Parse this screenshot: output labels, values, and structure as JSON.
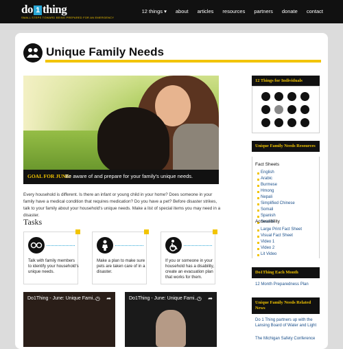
{
  "header": {
    "logo_left": "do",
    "logo_one": "1",
    "logo_right": "thing",
    "tagline": "SMALL STEPS TOWARD BEING PREPARED FOR AN EMERGENCY",
    "nav": [
      "12 things ▾",
      "about",
      "articles",
      "resources",
      "partners",
      "donate",
      "contact"
    ]
  },
  "page": {
    "title": "Unique Family Needs",
    "title_icon": "family-icon",
    "goal_label": "GOAL FOR JUNE:",
    "goal_text": "Be aware of and prepare for your family's unique needs.",
    "intro": "Every household is different. Is there an infant or young child in your home? Does someone in your family have a medical condition that requires medication? Do you have a pet? Before disaster strikes, talk to your family about your household's unique needs. Make a list of special items you may need in a disaster.",
    "tasks_heading": "Tasks",
    "tasks": [
      {
        "icon": "glasses-icon",
        "text": "Talk with family members to identify your household's unique needs."
      },
      {
        "icon": "person-icon",
        "text": "Make a plan to make sure pets are taken care of in a disaster."
      },
      {
        "icon": "wheelchair-icon",
        "text": "If you or someone in your household has a disability, create an evacuation plan that works for them."
      }
    ],
    "videos": [
      {
        "title": "Do1Thing - June: Unique Fami..."
      },
      {
        "title": "Do1Thing - June: Unique Fami..."
      }
    ]
  },
  "sidebar": {
    "things_heading": "12 Things for Individuals",
    "thing_icons": [
      "question-icon",
      "water-drop-icon",
      "fire-extinguisher-icon",
      "supplies-icon",
      "shelter-icon",
      "documents-icon",
      "family-icon",
      "radio-icon",
      "medical-icon",
      "sound-icon",
      "lightbulb-icon",
      "first-aid-icon"
    ],
    "resources_heading": "Unique Family Needs Resources",
    "fact_sheets_label": "Fact Sheets",
    "fact_sheets": [
      "English",
      "Arabic",
      "Burmese",
      "Hmong",
      "Nepali",
      "Simplified Chinese",
      "Somali",
      "Spanish",
      "Swahili"
    ],
    "accessibility_label": "Accessibility",
    "accessibility": [
      "Large Print Fact Sheet",
      "Visual Fact Sheet",
      "Video 1",
      "Video 2",
      "Lit Video"
    ],
    "each_month_heading": "Do1Thing Each Month",
    "each_month_link": "12 Month Preparedness Plan",
    "related_heading": "Unique Family Needs Related News",
    "related": [
      "Do 1 Thing partners up with the Lansing Board of Water and Light",
      "The Michigan Safety Conference"
    ]
  },
  "colors": {
    "accent": "#f2c400",
    "link": "#1a4f8a",
    "dark": "#111111",
    "logo_blue": "#2aa7d6"
  }
}
